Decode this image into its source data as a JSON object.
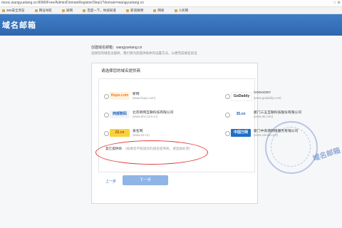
{
  "browser": {
    "url": "mooc.wangyuetang.cn:8080/Free/Admin/DomainRegister/Step1?domain=wangyuetang.cn",
    "tools": "☆ ⚙"
  },
  "favorites": [
    "360安全浏览",
    "网址导航",
    "知网",
    "百度一下，你就知道",
    "新浪微博",
    "网易",
    "人民网"
  ],
  "page": {
    "header_title": "域名邮箱",
    "info_line1": "创建域名邮箱：wangyuetang.cn",
    "info_line2": "选择您的域名注册商，我们将为您提供具体的设置方法，以便完成域名验证"
  },
  "panel": {
    "title": "请选择您的域名提供商"
  },
  "providers": [
    {
      "logo": "Hupo.com",
      "name": "新网",
      "url": "(www.hupo.com)"
    },
    {
      "logo": "GoDaddy",
      "name": "GODADDY",
      "url": "(www.godaddy.com)"
    },
    {
      "logo": "西部数码",
      "name": "北京新网互联科技有限公司",
      "url": "(www.dns.com.cn)"
    },
    {
      "logo": "35.cn",
      "name": "厦门三五互联科技股份有限公司",
      "url": "(www.35.com)"
    },
    {
      "logo": "22.cn",
      "name": "爱名网",
      "url": "(www.22.cn)"
    },
    {
      "logo": "中国万网",
      "name": "厦门中资源网络服务有限公司",
      "url": "(www.xinnet.com)"
    }
  ],
  "own_provider": {
    "label": "其它提供商",
    "description": "(如果您不知道您的域名提供商，请选择此项)"
  },
  "buttons": {
    "prev": "上一步",
    "next": "下一步"
  },
  "stamp_text": "域名邮箱",
  "colors": {
    "header": "#2f67ae",
    "next_button": "#8fb4e6",
    "annotation": "#e23b3b"
  }
}
